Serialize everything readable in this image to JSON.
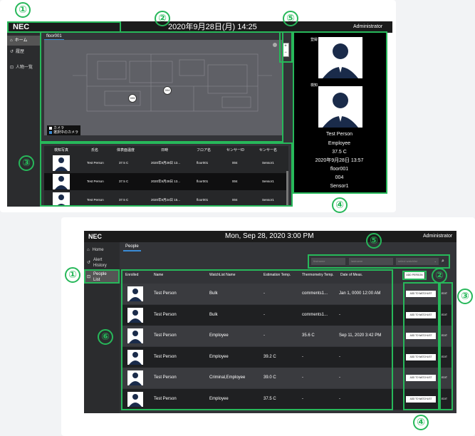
{
  "annotations": {
    "labels": [
      "①",
      "②",
      "③",
      "④",
      "⑤",
      "⑥"
    ]
  },
  "shot1": {
    "logo": "NEC",
    "datetime": "2020年9月28日(月) 14:25",
    "user": "Administrator",
    "nav": [
      {
        "label": "ホーム",
        "icon": "home-icon"
      },
      {
        "label": "履歴",
        "icon": "history-icon"
      },
      {
        "label": "人物一覧",
        "icon": "people-list-icon"
      }
    ],
    "map_tab": "floor001",
    "map_pins": [
      "005",
      "004"
    ],
    "legend": [
      "カメラ",
      "選択中のカメラ"
    ],
    "zoom": [
      "+",
      "−"
    ],
    "table": {
      "columns": [
        "検知写真",
        "氏名",
        "体表面温度",
        "日時",
        "フロア名",
        "センサーID",
        "センサー名"
      ],
      "rows": [
        [
          "Test Person",
          "37.5 C",
          "2020年9月28日 13...",
          "floor001",
          "004",
          "Sensor1"
        ],
        [
          "Test Person",
          "37.5 C",
          "2020年9月28日 13...",
          "floor001",
          "004",
          "Sensor1"
        ],
        [
          "Test Person",
          "37.5 C",
          "2020年9月24日 15...",
          "floor001",
          "004",
          "Sensor1"
        ]
      ]
    },
    "detail": {
      "enrolled_label": "登録",
      "detected_label": "検知",
      "name": "Test Person",
      "watchlist": "Employee",
      "temperature": "37.5 C",
      "datetime": "2020年9月28日 13:57",
      "floor": "floor001",
      "sensor_id": "004",
      "sensor_name": "Sensor1"
    }
  },
  "shot2": {
    "logo": "NEC",
    "datetime": "Mon, Sep 28, 2020 3:00 PM",
    "user": "Administrator",
    "nav": [
      {
        "label": "Home",
        "icon": "home-icon"
      },
      {
        "label": "Alert History",
        "icon": "history-icon"
      },
      {
        "label": "People List",
        "icon": "people-list-icon"
      }
    ],
    "tab": "People",
    "search": {
      "first_name": "firstname",
      "last_name": "lastname",
      "watchlist": "select watchlist"
    },
    "add_person": "ADD PERSON",
    "columns": [
      "Enrolled",
      "Name",
      "WatchList Name",
      "Estimation Temp.",
      "Thermometry Temp.",
      "Date of Meas."
    ],
    "add_to_watchlist": "ADD TO WATCHLIST",
    "edit": "EDIT",
    "rows": [
      {
        "name": "Test Person",
        "watchlist": "Bulk",
        "est": "-",
        "thermo": "comments1...",
        "date": "Jan 1, 0000 12:00 AM"
      },
      {
        "name": "Test Person",
        "watchlist": "Bulk",
        "est": "-",
        "thermo": "comments1...",
        "date": "-"
      },
      {
        "name": "Test Person",
        "watchlist": "Employee",
        "est": "-",
        "thermo": "35.6 C",
        "date": "Sep 11, 2020 3:42 PM"
      },
      {
        "name": "Test Person",
        "watchlist": "Employee",
        "est": "39.2 C",
        "thermo": "-",
        "date": "-"
      },
      {
        "name": "Test Person",
        "watchlist": "Criminal,Employee",
        "est": "39.0 C",
        "thermo": "-",
        "date": "-"
      },
      {
        "name": "Test Person",
        "watchlist": "Employee",
        "est": "37.5 C",
        "thermo": "-",
        "date": "-"
      }
    ]
  },
  "colors": {
    "annotation": "#27b85a",
    "header": "#1b1b1b",
    "sidebar": "#2b2c2e",
    "accent": "#3a8bd6"
  }
}
